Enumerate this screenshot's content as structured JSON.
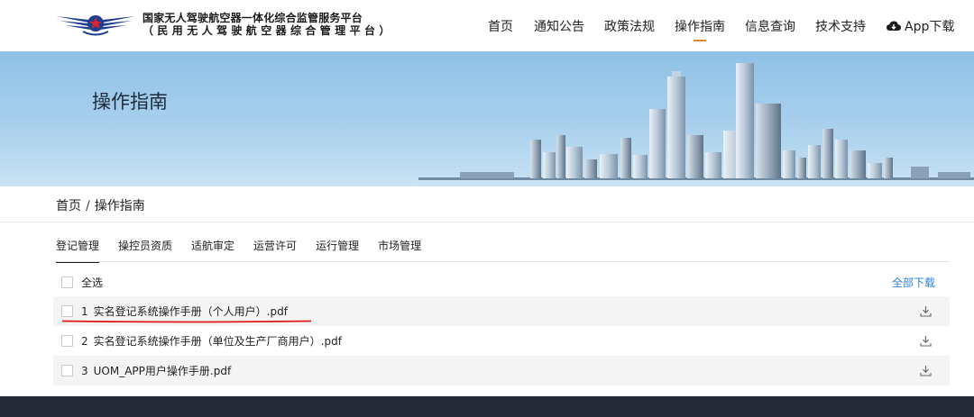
{
  "header": {
    "platform_name": "国家无人驾驶航空器一体化综合监管服务平台",
    "platform_subname": "（民用无人驾驶航空器综合管理平台）",
    "nav": [
      {
        "label": "首页"
      },
      {
        "label": "通知公告"
      },
      {
        "label": "政策法规"
      },
      {
        "label": "操作指南",
        "active": true
      },
      {
        "label": "信息查询"
      },
      {
        "label": "技术支持"
      }
    ],
    "app_download": "App下载"
  },
  "banner": {
    "title": "操作指南"
  },
  "breadcrumb": {
    "home": "首页",
    "separator": "/",
    "current": "操作指南"
  },
  "tabs": [
    {
      "label": "登记管理",
      "active": true
    },
    {
      "label": "操控员资质"
    },
    {
      "label": "适航审定"
    },
    {
      "label": "运营许可"
    },
    {
      "label": "运行管理"
    },
    {
      "label": "市场管理"
    }
  ],
  "list": {
    "select_all": "全选",
    "download_all": "全部下载",
    "files": [
      {
        "index": "1",
        "name": "实名登记系统操作手册（个人用户）.pdf"
      },
      {
        "index": "2",
        "name": "实名登记系统操作手册（单位及生产厂商用户）.pdf"
      },
      {
        "index": "3",
        "name": "UOM_APP用户操作手册.pdf"
      }
    ]
  },
  "colors": {
    "accent_orange": "#e58a2a",
    "link_blue": "#2f7fd6",
    "logo_red": "#d6252b",
    "logo_blue": "#1e3e8f",
    "annotation_red": "#e01a1a",
    "footer": "#232a36"
  },
  "icons": {
    "app_download": "cloud-download-icon",
    "file_download": "download-icon"
  }
}
